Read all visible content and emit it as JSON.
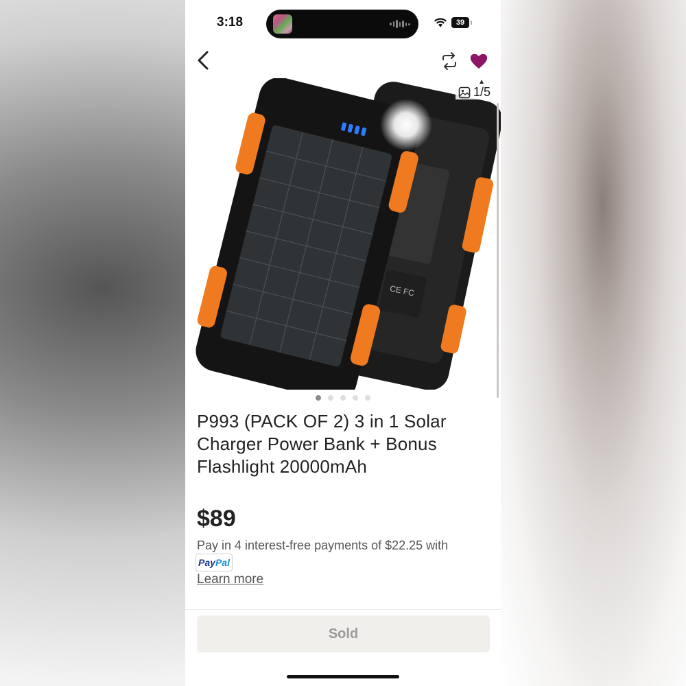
{
  "status_bar": {
    "time": "3:18",
    "battery": "39"
  },
  "gallery": {
    "counter": "1/5",
    "current": 1,
    "total": 5
  },
  "listing": {
    "title": "P993 (PACK OF 2) 3 in 1 Solar Charger Power Bank + Bonus Flashlight 20000mAh",
    "price": "$89",
    "installments": "Pay in 4 interest-free payments of $22.25 with",
    "paypal_badge": {
      "pay": "Pay",
      "pal": "Pal"
    },
    "learn_more": "Learn more",
    "status_button": "Sold"
  },
  "icons": {
    "back": "chevron-left-icon",
    "repost": "repost-icon",
    "like": "heart-icon",
    "gallery": "image-icon"
  },
  "colors": {
    "heart": "#8c1565",
    "orange_accent": "#f07a1f",
    "sold_button_bg": "#f1efec",
    "sold_button_text": "#9a9a9a"
  }
}
